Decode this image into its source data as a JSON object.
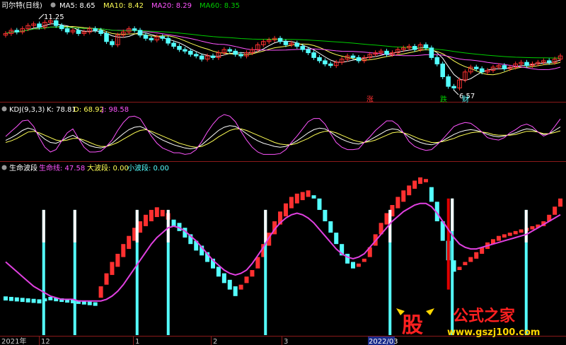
{
  "colors": {
    "background": "#000000",
    "separator": "#8b1a1a",
    "up": "#ff3030",
    "down": "#54ffff",
    "ma5": "#ffffff",
    "ma10": "#ffff55",
    "ma20": "#ff55ff",
    "ma60": "#00cc00",
    "kdj_k": "#ffffff",
    "kdj_d": "#ffff55",
    "kdj_j": "#ff55ff",
    "lifeline": "#e040e0",
    "big_wave": "#ffff55",
    "small_wave": "#54ffff",
    "marker_zhang": "#ff3030",
    "marker_die": "#00cc00",
    "marker_cai": "#54ffff",
    "watermark_red": "#ff2020",
    "watermark_yellow": "#ffd700"
  },
  "main_panel": {
    "title": "司尔特(日线)",
    "legend": [
      {
        "label": "MA5: 8.65",
        "color": "#ffffff"
      },
      {
        "label": "MA10: 8.42",
        "color": "#ffff55"
      },
      {
        "label": "MA20: 8.29",
        "color": "#ff55ff"
      },
      {
        "label": "MA60: 8.35",
        "color": "#00cc00"
      }
    ],
    "high_label": "11.25",
    "low_label": "6.57",
    "markers": [
      {
        "text": "涨",
        "color": "#ff3030"
      },
      {
        "text": "跌",
        "color": "#00cc00"
      },
      {
        "text": "财",
        "color": "#54ffff"
      }
    ]
  },
  "kdj_panel": {
    "title": "KDJ(9,3,3)",
    "legend": [
      {
        "label": "K: 78.81",
        "color": "#ffffff"
      },
      {
        "label": "D: 68.92",
        "color": "#ffff55"
      },
      {
        "label": "J: 98.58",
        "color": "#ff55ff"
      }
    ]
  },
  "wave_panel": {
    "title": "生命波段",
    "legend": [
      {
        "label": "生命线: 47.58",
        "color": "#ff55ff"
      },
      {
        "label": "大波段: 0.00",
        "color": "#ffff55"
      },
      {
        "label": "小波段: 0.00",
        "color": "#54ffff"
      }
    ]
  },
  "x_axis": {
    "labels": [
      "2021年",
      "12",
      "1",
      "2",
      "3",
      "2022/03"
    ]
  },
  "watermark": {
    "logo_text": "股",
    "site_name": "公式之家",
    "url": "www.gszj100.com"
  },
  "chart_data": [
    {
      "type": "candlestick",
      "title": "司尔特(日线)",
      "n_days": 100,
      "price_range": [
        6.3,
        11.6
      ],
      "close": [
        10.3,
        10.5,
        10.4,
        10.6,
        10.8,
        10.9,
        10.7,
        11.0,
        11.1,
        10.8,
        10.6,
        10.4,
        10.5,
        10.3,
        10.4,
        10.6,
        10.5,
        10.3,
        9.8,
        9.6,
        10.2,
        10.4,
        10.6,
        10.5,
        10.2,
        10.0,
        9.9,
        10.1,
        10.0,
        9.7,
        9.5,
        9.3,
        9.2,
        9.0,
        8.9,
        8.7,
        8.9,
        8.8,
        9.1,
        9.3,
        9.2,
        9.0,
        8.9,
        9.1,
        9.3,
        9.6,
        9.8,
        9.9,
        10.0,
        9.8,
        9.6,
        9.7,
        9.5,
        9.3,
        9.1,
        8.8,
        8.6,
        8.4,
        8.3,
        8.5,
        8.7,
        8.9,
        8.8,
        8.6,
        8.8,
        9.0,
        9.1,
        9.2,
        9.0,
        9.1,
        9.3,
        9.4,
        9.5,
        9.3,
        9.6,
        9.4,
        8.8,
        8.4,
        7.6,
        7.0,
        6.9,
        7.4,
        7.9,
        8.2,
        8.1,
        7.9,
        8.0,
        8.2,
        8.3,
        8.1,
        8.2,
        8.4,
        8.5,
        8.3,
        8.4,
        8.5,
        8.6,
        8.5,
        8.7,
        8.9
      ],
      "ma_windows": [
        5,
        10,
        20,
        60
      ]
    },
    {
      "type": "line",
      "title": "KDJ(9,3,3)",
      "series": [
        {
          "name": "K",
          "values": [
            45,
            52,
            60,
            70,
            76,
            72,
            60,
            48,
            40,
            38,
            44,
            52,
            58,
            50,
            40,
            32,
            28,
            26,
            30,
            38,
            50,
            62,
            72,
            78,
            80,
            74,
            64,
            54,
            46,
            40,
            34,
            30,
            26,
            24,
            26,
            34,
            46,
            58,
            70,
            78,
            82,
            80,
            72,
            62,
            52,
            44,
            38,
            34,
            30,
            28,
            30,
            36,
            44,
            54,
            64,
            72,
            76,
            74,
            66,
            56,
            48,
            42,
            38,
            36,
            40,
            46,
            54,
            62,
            70,
            74,
            72,
            64,
            54,
            46,
            40,
            36,
            34,
            38,
            44,
            52,
            60,
            66,
            70,
            72,
            70,
            66,
            60,
            56,
            54,
            56,
            60,
            64,
            70,
            74,
            72,
            66,
            60,
            62,
            70,
            79
          ]
        },
        {
          "name": "D",
          "values": [
            40,
            44,
            50,
            58,
            66,
            68,
            64,
            58,
            52,
            46,
            44,
            46,
            50,
            50,
            46,
            40,
            34,
            30,
            30,
            34,
            40,
            48,
            56,
            64,
            70,
            72,
            68,
            62,
            56,
            50,
            44,
            38,
            34,
            30,
            28,
            30,
            36,
            44,
            54,
            62,
            70,
            74,
            74,
            70,
            64,
            58,
            52,
            46,
            40,
            36,
            34,
            34,
            38,
            44,
            50,
            58,
            64,
            68,
            68,
            64,
            58,
            52,
            46,
            42,
            40,
            42,
            46,
            52,
            58,
            64,
            66,
            64,
            60,
            54,
            48,
            44,
            40,
            40,
            42,
            46,
            50,
            56,
            60,
            64,
            66,
            66,
            64,
            60,
            58,
            58,
            58,
            60,
            64,
            68,
            68,
            66,
            62,
            62,
            65,
            69
          ]
        },
        {
          "name": "J",
          "values": [
            55,
            68,
            80,
            94,
            96,
            80,
            52,
            28,
            16,
            22,
            44,
            64,
            74,
            50,
            28,
            16,
            16,
            18,
            30,
            46,
            70,
            90,
            104,
            106,
            100,
            78,
            56,
            38,
            26,
            20,
            14,
            14,
            10,
            12,
            22,
            42,
            66,
            86,
            102,
            110,
            106,
            92,
            68,
            46,
            28,
            16,
            10,
            10,
            10,
            12,
            22,
            40,
            56,
            74,
            92,
            100,
            100,
            86,
            62,
            40,
            28,
            22,
            22,
            24,
            40,
            54,
            70,
            82,
            94,
            94,
            84,
            64,
            42,
            30,
            24,
            20,
            22,
            34,
            48,
            64,
            80,
            86,
            90,
            88,
            78,
            66,
            52,
            48,
            46,
            52,
            64,
            72,
            82,
            86,
            80,
            66,
            56,
            62,
            80,
            99
          ]
        }
      ],
      "ylim": [
        0,
        110
      ]
    },
    {
      "type": "bar",
      "title": "生命波段",
      "n_bars": 100,
      "bars": [
        [
          23.8,
          21.3
        ],
        [
          23.5,
          21.0
        ],
        [
          23.2,
          20.7
        ],
        [
          22.9,
          20.4
        ],
        [
          22.6,
          20.1
        ],
        [
          22.3,
          19.8
        ],
        [
          22.0,
          19.5
        ],
        [
          22.6,
          20.8
        ],
        [
          23.5,
          21.4
        ],
        [
          23.0,
          20.8
        ],
        [
          22.6,
          20.4
        ],
        [
          22.2,
          20.0
        ],
        [
          21.8,
          19.6
        ],
        [
          21.4,
          19.2
        ],
        [
          21.0,
          18.8
        ],
        [
          20.6,
          18.4
        ],
        [
          20.2,
          18.0
        ],
        [
          23.0,
          30.0
        ],
        [
          31.0,
          38.0
        ],
        [
          37.0,
          45.0
        ],
        [
          42.0,
          50.0
        ],
        [
          48.0,
          56.0
        ],
        [
          53.0,
          61.0
        ],
        [
          58.0,
          66.0
        ],
        [
          63.0,
          70.0
        ],
        [
          67.0,
          74.0
        ],
        [
          70.0,
          77.0
        ],
        [
          72.6,
          78.6
        ],
        [
          73.0,
          77.0
        ],
        [
          71.0,
          75.0
        ],
        [
          71.0,
          67.0
        ],
        [
          69.0,
          64.0
        ],
        [
          66.0,
          60.0
        ],
        [
          62.0,
          56.0
        ],
        [
          58.0,
          52.0
        ],
        [
          55.0,
          49.0
        ],
        [
          51.0,
          45.0
        ],
        [
          47.0,
          41.0
        ],
        [
          42.0,
          36.0
        ],
        [
          38.0,
          32.0
        ],
        [
          34.0,
          28.0
        ],
        [
          30.0,
          24.0
        ],
        [
          28.0,
          31.0
        ],
        [
          32.0,
          36.0
        ],
        [
          36.0,
          40.0
        ],
        [
          41.0,
          48.0
        ],
        [
          48.0,
          56.0
        ],
        [
          55.0,
          63.0
        ],
        [
          62.0,
          70.0
        ],
        [
          68.0,
          76.0
        ],
        [
          73.0,
          81.0
        ],
        [
          78.0,
          85.0
        ],
        [
          81.0,
          87.0
        ],
        [
          83.0,
          88.0
        ],
        [
          85.0,
          89.0
        ],
        [
          86.0,
          84.0
        ],
        [
          84.0,
          77.0
        ],
        [
          77.0,
          70.0
        ],
        [
          70.0,
          63.0
        ],
        [
          63.0,
          56.0
        ],
        [
          56.0,
          49.0
        ],
        [
          50.0,
          44.0
        ],
        [
          45.0,
          41.0
        ],
        [
          42.0,
          44.0
        ],
        [
          45.0,
          47.0
        ],
        [
          48.0,
          54.0
        ],
        [
          55.0,
          62.0
        ],
        [
          62.0,
          69.0
        ],
        [
          68.0,
          75.0
        ],
        [
          73.0,
          80.0
        ],
        [
          78.0,
          85.0
        ],
        [
          82.0,
          89.0
        ],
        [
          86.0,
          92.0
        ],
        [
          90.0,
          95.0
        ],
        [
          93.0,
          97.0
        ],
        [
          94.0,
          96.0
        ],
        [
          91.0,
          82.0
        ],
        [
          82.0,
          70.0
        ],
        [
          70.0,
          58.0
        ],
        [
          58.0,
          46.0
        ],
        [
          46.0,
          39.0
        ],
        [
          40.0,
          42.0
        ],
        [
          43.0,
          45.0
        ],
        [
          45.0,
          48.0
        ],
        [
          47.0,
          51.0
        ],
        [
          50.0,
          54.0
        ],
        [
          53.0,
          57.0
        ],
        [
          56.0,
          59.0
        ],
        [
          58.0,
          61.0
        ],
        [
          60.0,
          62.0
        ],
        [
          61.0,
          63.0
        ],
        [
          62.0,
          64.0
        ],
        [
          63.0,
          65.0
        ],
        [
          64.0,
          66.0
        ],
        [
          65.0,
          67.0
        ],
        [
          66.0,
          68.0
        ],
        [
          67.0,
          70.0
        ],
        [
          70.0,
          74.0
        ],
        [
          74.0,
          79.0
        ],
        [
          79.0,
          84.0
        ]
      ],
      "long_bars": [
        {
          "day": 10,
          "color": "cyan",
          "range": [
            0,
            77
          ]
        },
        {
          "day": 18,
          "color": "cyan",
          "range": [
            0,
            77
          ]
        },
        {
          "day": 34,
          "color": "cyan",
          "range": [
            0,
            77
          ]
        },
        {
          "day": 42,
          "color": "cyan",
          "range": [
            0,
            77
          ]
        },
        {
          "day": 67,
          "color": "cyan",
          "range": [
            0,
            77
          ]
        },
        {
          "day": 99,
          "color": "cyan",
          "range": [
            0,
            77
          ]
        },
        {
          "day": 114,
          "color": "red",
          "range": [
            28,
            84
          ]
        },
        {
          "day": 115,
          "color": "cyan",
          "range": [
            0,
            84
          ]
        },
        {
          "day": 134,
          "color": "cyan",
          "range": [
            0,
            77
          ]
        }
      ],
      "lifeline": [
        45,
        42,
        39,
        36,
        33,
        30,
        28,
        26,
        24,
        23,
        22,
        22,
        22,
        21,
        21,
        21,
        21,
        21,
        22,
        24,
        27,
        31,
        36,
        41,
        46,
        51,
        56,
        60,
        63,
        66,
        67,
        66,
        64,
        61,
        58,
        54,
        50,
        46,
        43,
        40,
        38,
        37,
        38,
        40,
        44,
        49,
        54,
        60,
        65,
        69,
        72,
        74,
        75,
        74,
        72,
        69,
        65,
        61,
        57,
        53,
        50,
        48,
        47,
        48,
        50,
        54,
        58,
        62,
        66,
        70,
        73,
        76,
        78,
        80,
        81,
        81,
        79,
        75,
        70,
        65,
        60,
        56,
        54,
        53,
        53,
        54,
        55,
        56,
        57,
        58,
        59,
        60,
        61,
        62,
        64,
        66,
        68,
        70,
        72,
        74
      ],
      "ylim": [
        0,
        100
      ]
    }
  ]
}
